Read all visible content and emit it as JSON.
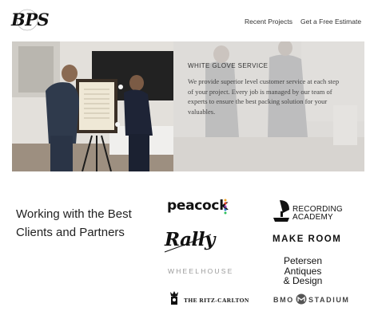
{
  "header": {
    "logo_text": "BPS",
    "nav": [
      {
        "label": "Recent Projects"
      },
      {
        "label": "Get a Free Estimate"
      }
    ]
  },
  "hero": {
    "title": "WHITE GLOVE SERVICE",
    "body": "We provide superior level customer service at each step of your project.  Every job is managed by our team of experts to ensure the best packing solution for your valuables."
  },
  "clients": {
    "heading": "Working with the Best Clients and Partners",
    "logos": {
      "peacock": "peacock",
      "rally": "Rally",
      "wheelhouse": "WHEELHOUSE",
      "ritz": "THE RITZ-CARLTON",
      "recording_line1": "RECORDING",
      "recording_line2": "ACADEMY",
      "makeroom": "MAKE ROOM",
      "petersen_line1": "Petersen",
      "petersen_line2": "Antiques",
      "petersen_line3": "& Design",
      "bmo": "BMO",
      "stadium": "STADIUM"
    }
  },
  "colors": {
    "text": "#222222",
    "muted": "#9a9a9a",
    "hero_overlay": "#e4e2e0"
  }
}
